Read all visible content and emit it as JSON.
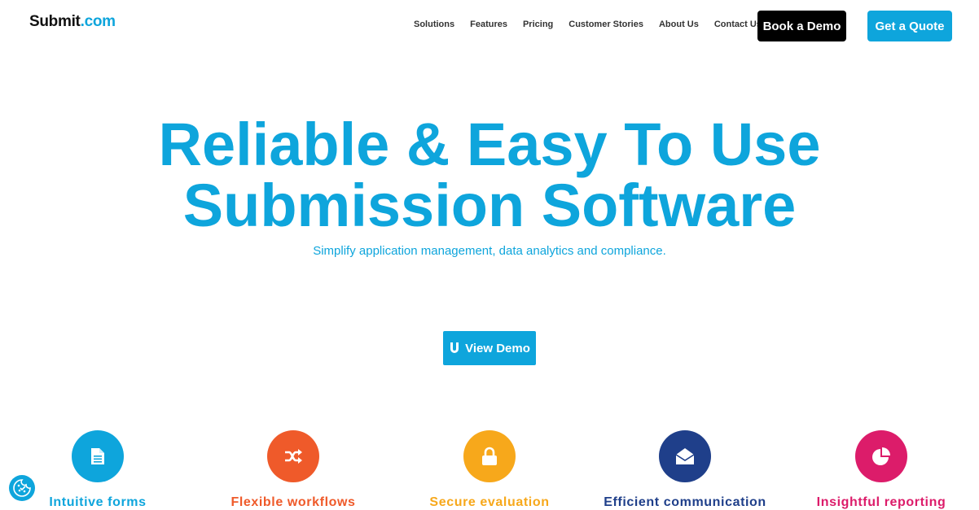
{
  "logo": {
    "part1": "Submit",
    "part2": ".com"
  },
  "nav": {
    "items": [
      "Solutions",
      "Features",
      "Pricing",
      "Customer Stories",
      "About Us",
      "Contact Us"
    ]
  },
  "header_buttons": {
    "book_demo": "Book a Demo",
    "get_quote": "Get a Quote"
  },
  "hero": {
    "title_line1": "Reliable & Easy To Use",
    "title_line2": "Submission Software",
    "subtitle": "Simplify application management, data analytics and compliance.",
    "cta": "View Demo"
  },
  "features": [
    {
      "label": "Intuitive forms",
      "color": "#0ea5dc",
      "icon": "document-icon"
    },
    {
      "label": "Flexible workflows",
      "color": "#ef5a2a",
      "icon": "shuffle-icon"
    },
    {
      "label": "Secure evaluation",
      "color": "#f7a81b",
      "icon": "lock-icon"
    },
    {
      "label": "Efficient communication",
      "color": "#1f3f8a",
      "icon": "envelope-open-icon"
    },
    {
      "label": "Insightful reporting",
      "color": "#dc1c6a",
      "icon": "pie-chart-icon"
    }
  ],
  "colors": {
    "brand": "#0ea5dc",
    "dark": "#000000"
  },
  "cookie_widget": {
    "icon": "cookie-settings-icon"
  }
}
